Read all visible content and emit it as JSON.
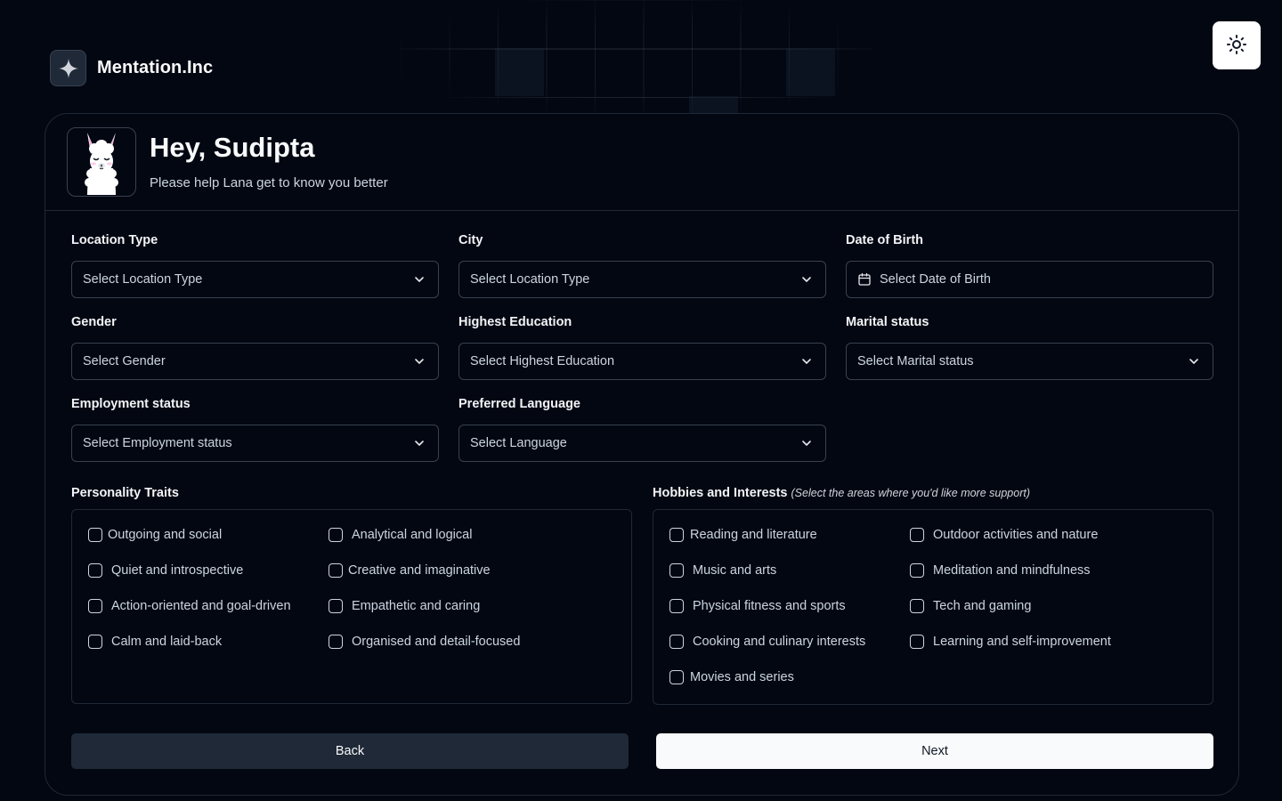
{
  "brand": {
    "name": "Mentation.Inc",
    "logo_icon": "sparkle-icon"
  },
  "theme_toggle": {
    "icon": "sun-icon"
  },
  "header": {
    "greeting": "Hey, Sudipta",
    "subtitle": "Please help Lana get to know you better",
    "avatar_icon": "llama-icon"
  },
  "fields": {
    "location_type": {
      "label": "Location Type",
      "placeholder": "Select Location Type"
    },
    "city": {
      "label": "City",
      "placeholder": "Select Location Type"
    },
    "dob": {
      "label": "Date of Birth",
      "placeholder": "Select Date of Birth"
    },
    "gender": {
      "label": "Gender",
      "placeholder": "Select Gender"
    },
    "education": {
      "label": "Highest Education",
      "placeholder": "Select Highest Education"
    },
    "marital": {
      "label": "Marital status",
      "placeholder": "Select Marital status"
    },
    "employment": {
      "label": "Employment status",
      "placeholder": "Select Employment status"
    },
    "language": {
      "label": "Preferred Language",
      "placeholder": "Select Language"
    }
  },
  "personality": {
    "label": "Personality Traits",
    "options": [
      "Outgoing and social",
      "Analytical and logical",
      "Quiet and introspective",
      "Creative and imaginative",
      "Action-oriented and goal-driven",
      "Empathetic and caring",
      "Calm and laid-back",
      "Organised and detail-focused"
    ]
  },
  "hobbies": {
    "label": "Hobbies and Interests",
    "hint": "(Select the areas where you'd like more support)",
    "options": [
      "Reading and literature",
      "Outdoor activities and nature",
      "Music and arts",
      "Meditation and mindfulness",
      "Physical fitness and sports",
      "Tech and gaming",
      "Cooking and culinary interests",
      "Learning and self-improvement",
      "Movies and series"
    ]
  },
  "buttons": {
    "back": "Back",
    "next": "Next"
  }
}
